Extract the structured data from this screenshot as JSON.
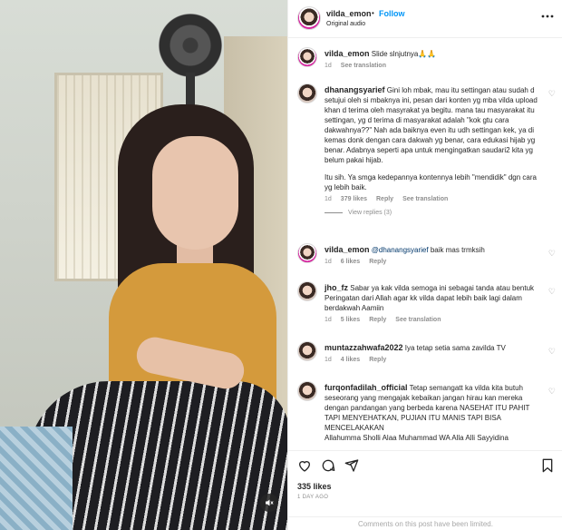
{
  "header": {
    "username": "vilda_emon",
    "separator": "•",
    "follow_label": "Follow",
    "audio_label": "Original audio",
    "more_icon": "more-horizontal-icon"
  },
  "caption": {
    "username": "vilda_emon",
    "text": "Slide slnjutnya🙏🙏",
    "time": "1d",
    "see_translation": "See translation"
  },
  "comments": [
    {
      "username": "dhanangsyarief",
      "text": "Gini loh mbak, mau itu settingan atau sudah d setujui oleh si mbaknya ini, pesan dari konten yg mba vilda upload khan d terima oleh masyrakat ya begitu. mana tau masyarakat itu settingan, yg d terima di masyarakat adalah \"kok gtu cara dakwahnya??\" Nah ada baiknya even itu udh settingan kek, ya di kemas donk dengan cara dakwah yg benar, cara edukasi hijab yg benar. Adabnya seperti apa untuk mengingatkan saudari2 kita yg belum pakai hijab.",
      "text2": "Itu sih. Ya smga kedepannya kontennya lebih \"mendidik\" dgn cara yg lebih baik.",
      "time": "1d",
      "likes": "379 likes",
      "reply": "Reply",
      "see_translation": "See translation",
      "view_replies": "View replies (3)"
    },
    {
      "username": "vilda_emon",
      "mention": "@dhanangsyarief",
      "text": "baik mas trmksih",
      "time": "1d",
      "likes": "6 likes",
      "reply": "Reply"
    },
    {
      "username": "jho_fz",
      "text": "Sabar ya kak vilda semoga ini sebagai tanda atau bentuk Peringatan dari Allah agar kk vilda dapat lebih baik lagi dalam berdakwah Aamiin",
      "time": "1d",
      "likes": "5 likes",
      "reply": "Reply",
      "see_translation": "See translation"
    },
    {
      "username": "muntazzahwafa2022",
      "text": "Iya tetap setia sama zavilda TV",
      "time": "1d",
      "likes": "4 likes",
      "reply": "Reply"
    },
    {
      "username": "furqonfadilah_official",
      "text": "Tetap semangatt ka vilda kita butuh seseorang yang mengajak kebaikan jangan hirau kan mereka dengan pandangan yang berbeda karena NASEHAT ITU PAHIT TAPI MENYEHATKAN, PUJIAN ITU MANIS TAPI BISA MENCELAKAKAN",
      "text2": "Allahumma Sholli Alaa Muhammad WA Alla Alli Sayyidina"
    }
  ],
  "footer": {
    "likes": "335 likes",
    "date": "1 DAY AGO",
    "comments_limited": "Comments on this post have been limited."
  }
}
